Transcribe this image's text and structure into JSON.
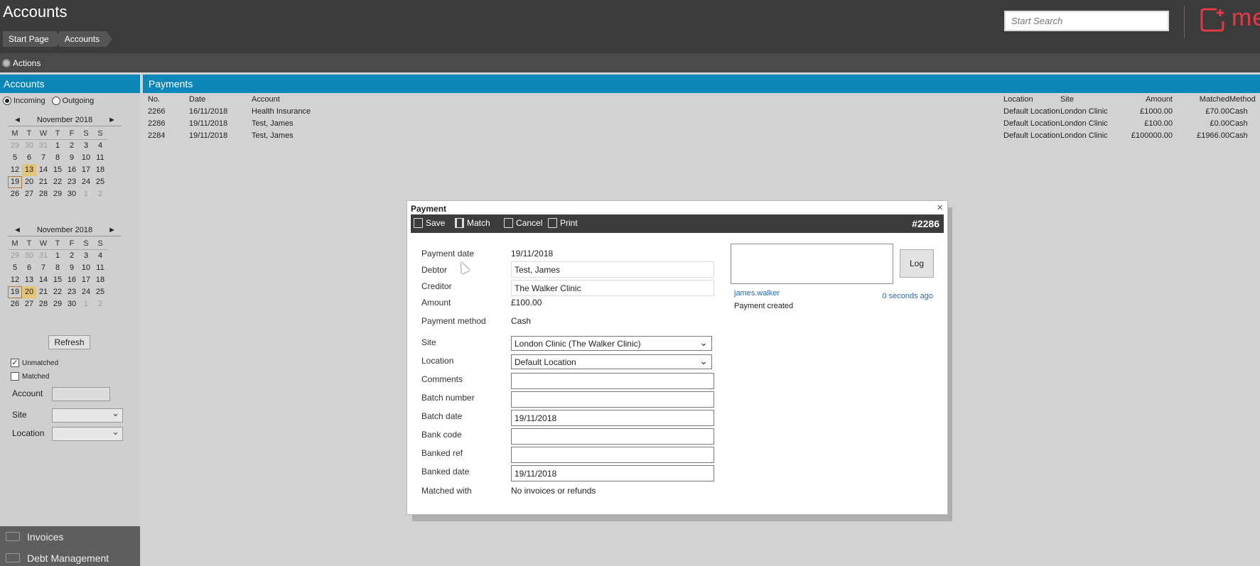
{
  "app": {
    "title": "Accounts",
    "logo_text": "me"
  },
  "breadcrumb": [
    "Start Page",
    "Accounts"
  ],
  "search": {
    "placeholder": "Start Search"
  },
  "actions_label": "Actions",
  "left_panel": {
    "title": "Accounts",
    "direction": {
      "incoming": "Incoming",
      "outgoing": "Outgoing",
      "selected": "Incoming"
    },
    "calendars": [
      {
        "month": "November 2018",
        "prev": "◄",
        "next": "►",
        "dow": [
          "M",
          "T",
          "W",
          "T",
          "F",
          "S",
          "S"
        ],
        "days": [
          "29",
          "30",
          "31",
          "1",
          "2",
          "3",
          "4",
          "5",
          "6",
          "7",
          "8",
          "9",
          "10",
          "11",
          "12",
          "13",
          "14",
          "15",
          "16",
          "17",
          "18",
          "19",
          "20",
          "21",
          "22",
          "23",
          "24",
          "25",
          "26",
          "27",
          "28",
          "29",
          "30",
          "1",
          "2"
        ],
        "selected": "13",
        "today": "19"
      },
      {
        "month": "November 2018",
        "prev": "◄",
        "next": "►",
        "dow": [
          "M",
          "T",
          "W",
          "T",
          "F",
          "S",
          "S"
        ],
        "days": [
          "29",
          "30",
          "31",
          "1",
          "2",
          "3",
          "4",
          "5",
          "6",
          "7",
          "8",
          "9",
          "10",
          "11",
          "12",
          "13",
          "14",
          "15",
          "16",
          "17",
          "18",
          "19",
          "20",
          "21",
          "22",
          "23",
          "24",
          "25",
          "26",
          "27",
          "28",
          "29",
          "30",
          "1",
          "2"
        ],
        "selected": "20",
        "today": "19"
      }
    ],
    "refresh": "Refresh",
    "unmatched": {
      "label": "Unmatched",
      "checked": true
    },
    "matched": {
      "label": "Matched",
      "checked": false
    },
    "account_label": "Account",
    "site_label": "Site",
    "location_label": "Location",
    "folders": [
      "Invoices",
      "Debt Management"
    ]
  },
  "payments": {
    "title": "Payments",
    "columns": {
      "no": "No.",
      "date": "Date",
      "account": "Account",
      "location": "Location",
      "site": "Site",
      "amount": "Amount",
      "matched": "Matched",
      "method": "Method"
    },
    "rows": [
      {
        "no": "2266",
        "date": "16/11/2018",
        "account": "Health Insurance",
        "location": "Default Location",
        "site": "London Clinic",
        "amount": "£1000.00",
        "matched": "£70.00",
        "method": "Cash"
      },
      {
        "no": "2286",
        "date": "19/11/2018",
        "account": "Test, James",
        "location": "Default Location",
        "site": "London Clinic",
        "amount": "£100.00",
        "matched": "£0.00",
        "method": "Cash"
      },
      {
        "no": "2284",
        "date": "19/11/2018",
        "account": "Test, James",
        "location": "Default Location",
        "site": "London Clinic",
        "amount": "£100000.00",
        "matched": "£1966.00",
        "method": "Cash"
      }
    ]
  },
  "modal": {
    "title": "Payment",
    "close": "×",
    "toolbar": {
      "save": "Save",
      "match": "Match",
      "cancel": "Cancel",
      "print": "Print"
    },
    "record_no": "#2286",
    "labels": {
      "payment_date": "Payment date",
      "debtor": "Debtor",
      "creditor": "Creditor",
      "amount": "Amount",
      "payment_method": "Payment method",
      "site": "Site",
      "location": "Location",
      "comments": "Comments",
      "batch_number": "Batch number",
      "batch_date": "Batch date",
      "bank_code": "Bank code",
      "banked_ref": "Banked ref",
      "banked_date": "Banked date",
      "matched_with": "Matched with"
    },
    "values": {
      "payment_date": "19/11/2018",
      "debtor": "Test, James",
      "creditor": "The Walker Clinic",
      "amount": "£100.00",
      "payment_method": "Cash",
      "site": "London Clinic (The Walker Clinic)",
      "location": "Default Location",
      "comments": "",
      "batch_number": "",
      "batch_date": "19/11/2018",
      "bank_code": "",
      "banked_ref": "",
      "banked_date": "19/11/2018",
      "matched_with": "No invoices or refunds"
    },
    "log": {
      "button": "Log",
      "user": "james.walker",
      "time": "0 seconds ago",
      "message": "Payment created"
    }
  },
  "colors": {
    "header_blue": "#0a86b8",
    "topbar": "#3b3b3b",
    "brand_red": "#e53945",
    "selected_day": "#e2c579"
  }
}
